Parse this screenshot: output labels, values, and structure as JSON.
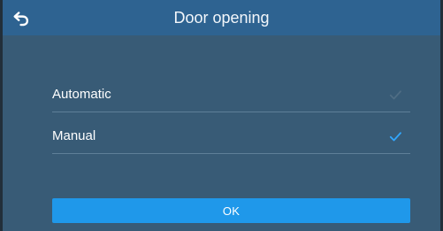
{
  "header": {
    "title": "Door opening",
    "back_icon": "back-arrow-icon"
  },
  "options": [
    {
      "label": "Automatic",
      "selected": false,
      "check_icon": "checkmark-icon",
      "check_color": "#4f6d84"
    },
    {
      "label": "Manual",
      "selected": true,
      "check_icon": "checkmark-icon",
      "check_color": "#31a7ff"
    }
  ],
  "actions": {
    "ok_label": "OK"
  },
  "colors": {
    "background": "#385b76",
    "header": "#2e6391",
    "button": "#1f98ea",
    "divider": "#5e7f98"
  }
}
